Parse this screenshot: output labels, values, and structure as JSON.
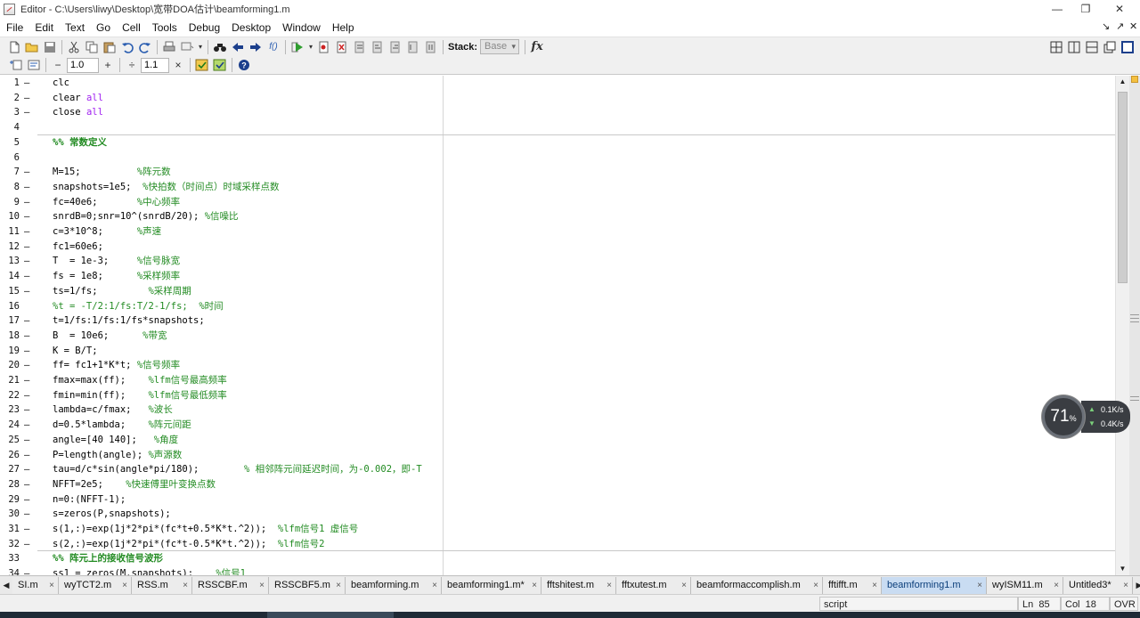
{
  "window": {
    "title": "Editor - C:\\Users\\liwy\\Desktop\\宽带DOA估计\\beamforming1.m",
    "minimize": "—",
    "maximize": "❐",
    "close": "✕"
  },
  "menu": [
    "File",
    "Edit",
    "Text",
    "Go",
    "Cell",
    "Tools",
    "Debug",
    "Desktop",
    "Window",
    "Help"
  ],
  "menu_right": {
    "undock": "↘",
    "pin": "↗",
    "close": "✕"
  },
  "toolbar": {
    "stack_label": "Stack:",
    "stack_value": "Base",
    "fx_label": "fx",
    "fx_small": "f()"
  },
  "cell_toolbar": {
    "minus": "−",
    "value1": "1.0",
    "plus": "+",
    "divide": "÷",
    "value2": "1.1",
    "times": "×"
  },
  "code_lines": [
    {
      "n": "1",
      "dash": "–",
      "parts": [
        {
          "t": "clc",
          "c": "k"
        }
      ]
    },
    {
      "n": "2",
      "dash": "–",
      "parts": [
        {
          "t": "clear ",
          "c": "k"
        },
        {
          "t": "all",
          "c": "s"
        }
      ]
    },
    {
      "n": "3",
      "dash": "–",
      "parts": [
        {
          "t": "close ",
          "c": "k"
        },
        {
          "t": "all",
          "c": "s"
        }
      ]
    },
    {
      "n": "4",
      "dash": "",
      "parts": []
    },
    {
      "n": "5",
      "dash": "",
      "parts": [
        {
          "t": "%% 常数定义",
          "c": "cell"
        }
      ]
    },
    {
      "n": "6",
      "dash": "",
      "parts": []
    },
    {
      "n": "7",
      "dash": "–",
      "parts": [
        {
          "t": "M=15;          ",
          "c": "k"
        },
        {
          "t": "%阵元数",
          "c": "c"
        }
      ]
    },
    {
      "n": "8",
      "dash": "–",
      "parts": [
        {
          "t": "snapshots=1e5;  ",
          "c": "k"
        },
        {
          "t": "%快拍数（时间点）时域采样点数",
          "c": "c"
        }
      ]
    },
    {
      "n": "9",
      "dash": "–",
      "parts": [
        {
          "t": "fc=40e6;       ",
          "c": "k"
        },
        {
          "t": "%中心频率",
          "c": "c"
        }
      ]
    },
    {
      "n": "10",
      "dash": "–",
      "parts": [
        {
          "t": "snrdB=0;snr=10^(snrdB/20); ",
          "c": "k"
        },
        {
          "t": "%信噪比",
          "c": "c"
        }
      ]
    },
    {
      "n": "11",
      "dash": "–",
      "parts": [
        {
          "t": "c=3*10^8;      ",
          "c": "k"
        },
        {
          "t": "%声速",
          "c": "c"
        }
      ]
    },
    {
      "n": "12",
      "dash": "–",
      "parts": [
        {
          "t": "fc1=60e6;",
          "c": "k"
        }
      ]
    },
    {
      "n": "13",
      "dash": "–",
      "parts": [
        {
          "t": "T  = 1e-3;     ",
          "c": "k"
        },
        {
          "t": "%信号脉宽",
          "c": "c"
        }
      ]
    },
    {
      "n": "14",
      "dash": "–",
      "parts": [
        {
          "t": "fs = 1e8;      ",
          "c": "k"
        },
        {
          "t": "%采样频率",
          "c": "c"
        }
      ]
    },
    {
      "n": "15",
      "dash": "–",
      "parts": [
        {
          "t": "ts=1/fs;         ",
          "c": "k"
        },
        {
          "t": "%采样周期",
          "c": "c"
        }
      ]
    },
    {
      "n": "16",
      "dash": "",
      "parts": [
        {
          "t": "%t = -T/2:1/fs:T/2-1/fs;  %时间",
          "c": "c"
        }
      ]
    },
    {
      "n": "17",
      "dash": "–",
      "parts": [
        {
          "t": "t=1/fs:1/fs:1/fs*snapshots;",
          "c": "k"
        }
      ]
    },
    {
      "n": "18",
      "dash": "–",
      "parts": [
        {
          "t": "B  = 10e6;      ",
          "c": "k"
        },
        {
          "t": "%带宽",
          "c": "c"
        }
      ]
    },
    {
      "n": "19",
      "dash": "–",
      "parts": [
        {
          "t": "K = B/T;",
          "c": "k"
        }
      ]
    },
    {
      "n": "20",
      "dash": "–",
      "parts": [
        {
          "t": "ff= fc1+1*K*t; ",
          "c": "k"
        },
        {
          "t": "%信号频率",
          "c": "c"
        }
      ]
    },
    {
      "n": "21",
      "dash": "–",
      "parts": [
        {
          "t": "fmax=max(ff);    ",
          "c": "k"
        },
        {
          "t": "%lfm信号最高频率",
          "c": "c"
        }
      ]
    },
    {
      "n": "22",
      "dash": "–",
      "parts": [
        {
          "t": "fmin=min(ff);    ",
          "c": "k"
        },
        {
          "t": "%lfm信号最低频率",
          "c": "c"
        }
      ]
    },
    {
      "n": "23",
      "dash": "–",
      "parts": [
        {
          "t": "lambda=c/fmax;   ",
          "c": "k"
        },
        {
          "t": "%波长",
          "c": "c"
        }
      ]
    },
    {
      "n": "24",
      "dash": "–",
      "parts": [
        {
          "t": "d=0.5*lambda;    ",
          "c": "k"
        },
        {
          "t": "%阵元间距",
          "c": "c"
        }
      ]
    },
    {
      "n": "25",
      "dash": "–",
      "parts": [
        {
          "t": "angle=[40 140];   ",
          "c": "k"
        },
        {
          "t": "%角度",
          "c": "c"
        }
      ]
    },
    {
      "n": "26",
      "dash": "–",
      "parts": [
        {
          "t": "P=length(angle); ",
          "c": "k"
        },
        {
          "t": "%声源数",
          "c": "c"
        }
      ]
    },
    {
      "n": "27",
      "dash": "–",
      "parts": [
        {
          "t": "tau=d/c*sin(angle*pi/180);        ",
          "c": "k"
        },
        {
          "t": "% 相邻阵元间延迟时间，为-0.002，即-T",
          "c": "c"
        }
      ]
    },
    {
      "n": "28",
      "dash": "–",
      "parts": [
        {
          "t": "NFFT=2e5;    ",
          "c": "k"
        },
        {
          "t": "%快速傅里叶变换点数",
          "c": "c"
        }
      ]
    },
    {
      "n": "29",
      "dash": "–",
      "parts": [
        {
          "t": "n=0:(NFFT-1);",
          "c": "k"
        }
      ]
    },
    {
      "n": "30",
      "dash": "–",
      "parts": [
        {
          "t": "s=zeros(P,snapshots);",
          "c": "k"
        }
      ]
    },
    {
      "n": "31",
      "dash": "–",
      "parts": [
        {
          "t": "s(1,:)=exp(1j*2*pi*(fc*t+0.5*K*t.^2));  ",
          "c": "k"
        },
        {
          "t": "%lfm信号1 虚信号",
          "c": "c"
        }
      ]
    },
    {
      "n": "32",
      "dash": "–",
      "parts": [
        {
          "t": "s(2,:)=exp(1j*2*pi*(fc*t-0.5*K*t.^2));  ",
          "c": "k"
        },
        {
          "t": "%lfm信号2",
          "c": "c"
        }
      ]
    },
    {
      "n": "33",
      "dash": "",
      "parts": [
        {
          "t": "%% 阵元上的接收信号波形",
          "c": "cell"
        }
      ]
    },
    {
      "n": "34",
      "dash": "–",
      "parts": [
        {
          "t": "ss1 = zeros(M,snapshots);    ",
          "c": "k"
        },
        {
          "t": "%信号1",
          "c": "c"
        }
      ]
    }
  ],
  "tabs": [
    {
      "label": "SI.m",
      "active": false
    },
    {
      "label": "wyTCT2.m",
      "active": false
    },
    {
      "label": "RSS.m",
      "active": false
    },
    {
      "label": "RSSCBF.m",
      "active": false
    },
    {
      "label": "RSSCBF5.m",
      "active": false
    },
    {
      "label": "beamforming.m",
      "active": false
    },
    {
      "label": "beamforming1.m*",
      "active": false
    },
    {
      "label": "fftshitest.m",
      "active": false
    },
    {
      "label": "fftxutest.m",
      "active": false
    },
    {
      "label": "beamformaccomplish.m",
      "active": false
    },
    {
      "label": "fftifft.m",
      "active": false
    },
    {
      "label": "beamforming1.m",
      "active": true
    },
    {
      "label": "wyISM11.m",
      "active": false
    },
    {
      "label": "Untitled3*",
      "active": false
    }
  ],
  "status": {
    "mode": "script",
    "ln_label": "Ln",
    "ln": "85",
    "col_label": "Col",
    "col": "18",
    "ovr": "OVR"
  },
  "net_widget": {
    "percent": "71",
    "percent_sign": "%",
    "up": "0.1K/s",
    "down": "0.4K/s"
  },
  "colors": {
    "comment": "#228b22",
    "string": "#a020f0",
    "active_tab": "#c9dcf2"
  }
}
